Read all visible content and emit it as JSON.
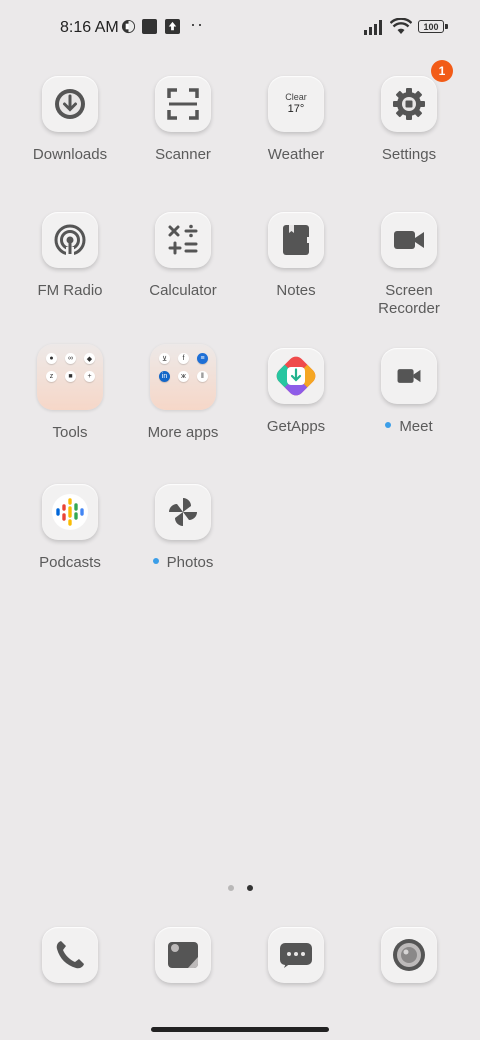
{
  "status_bar": {
    "time": "8:16 AM",
    "battery": "100"
  },
  "apps": [
    {
      "label": "Downloads",
      "icon": "download-icon"
    },
    {
      "label": "Scanner",
      "icon": "scanner-icon"
    },
    {
      "label": "Weather",
      "icon": "weather-icon",
      "weather_condition": "Clear",
      "weather_temp": "17°"
    },
    {
      "label": "Settings",
      "icon": "gear-icon",
      "badge": "1"
    },
    {
      "label": "FM Radio",
      "icon": "radio-icon"
    },
    {
      "label": "Calculator",
      "icon": "calculator-icon"
    },
    {
      "label": "Notes",
      "icon": "notes-icon"
    },
    {
      "label": "Screen\nRecorder",
      "label_line1": "Screen",
      "label_line2": "Recorder",
      "icon": "video-camera-icon"
    },
    {
      "label": "Tools",
      "icon": "folder-icon"
    },
    {
      "label": "More apps",
      "icon": "folder-icon"
    },
    {
      "label": "GetApps",
      "icon": "getapps-icon"
    },
    {
      "label": "Meet",
      "icon": "video-camera-icon",
      "new_dot": true
    },
    {
      "label": "Podcasts",
      "icon": "podcasts-icon"
    },
    {
      "label": "Photos",
      "icon": "pinwheel-icon",
      "new_dot": true
    }
  ],
  "dock": [
    {
      "name": "phone",
      "icon": "phone-icon"
    },
    {
      "name": "gallery",
      "icon": "gallery-icon"
    },
    {
      "name": "messages",
      "icon": "message-icon"
    },
    {
      "name": "camera",
      "icon": "camera-icon"
    }
  ],
  "pager": {
    "pages": 2,
    "current": 2
  },
  "colors": {
    "background": "#ebe9ea",
    "badge": "#f25b17",
    "new_dot": "#3b9ee8"
  }
}
